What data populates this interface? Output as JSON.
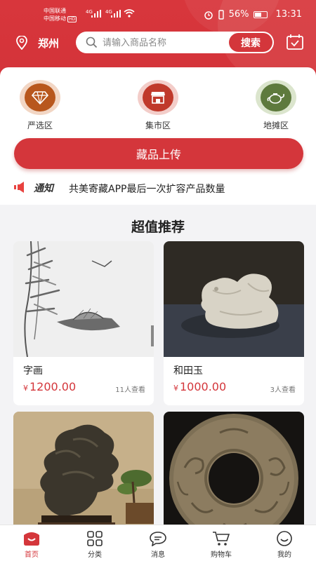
{
  "status_bar": {
    "carrier1": "中国联通",
    "carrier2": "中国移动",
    "hd": "HD",
    "network1": "4G",
    "network2": "4G",
    "battery": "56%",
    "time": "13:31"
  },
  "header": {
    "city": "郑州",
    "search_placeholder": "请输入商品名称",
    "search_button": "搜索"
  },
  "categories": [
    {
      "label": "严选区",
      "icon": "diamond-icon",
      "color": "#b8571d"
    },
    {
      "label": "集市区",
      "icon": "store-icon",
      "color": "#c0392b"
    },
    {
      "label": "地摊区",
      "icon": "teapot-icon",
      "color": "#5e7a3d"
    }
  ],
  "upload_button": "藏品上传",
  "notice": {
    "tag": "通知",
    "text": "共美寄藏APP最后一次扩容产品数量"
  },
  "section_title": "超值推荐",
  "products": [
    {
      "name": "字画",
      "currency": "¥",
      "price": "1200.00",
      "views": "11人查看"
    },
    {
      "name": "和田玉",
      "currency": "¥",
      "price": "1000.00",
      "views": "3人查看"
    },
    {
      "name": "",
      "currency": "",
      "price": "",
      "views": ""
    },
    {
      "name": "",
      "currency": "",
      "price": "",
      "views": ""
    }
  ],
  "tabs": [
    {
      "label": "首页",
      "active": true
    },
    {
      "label": "分类",
      "active": false
    },
    {
      "label": "消息",
      "active": false
    },
    {
      "label": "购物车",
      "active": false
    },
    {
      "label": "我的",
      "active": false
    }
  ],
  "colors": {
    "brand": "#d4363b",
    "background": "#f3f3f5"
  }
}
